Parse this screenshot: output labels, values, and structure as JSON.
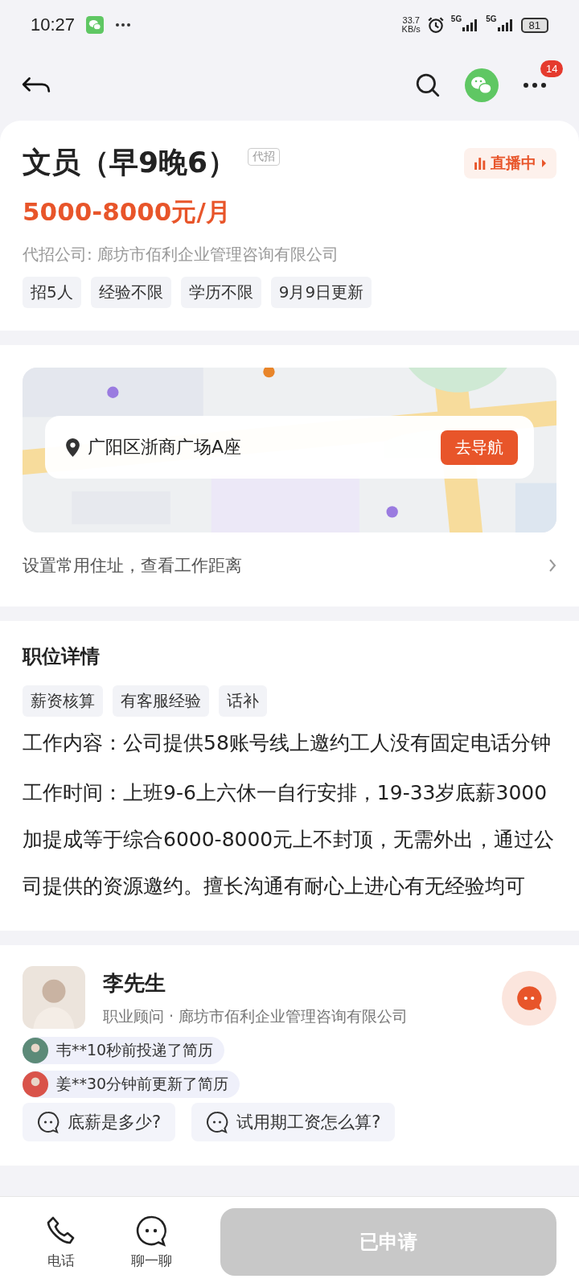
{
  "status_bar": {
    "time": "10:27",
    "net_speed": "33.7",
    "net_unit": "KB/s",
    "signal_1": "5G",
    "signal_2": "5G",
    "battery": "81"
  },
  "nav": {
    "badge": "14"
  },
  "job": {
    "title": "文员（早9晚6）",
    "agency_tag": "代招",
    "live": "直播中",
    "salary": "5000-8000元/月",
    "company": "代招公司: 廊坊市佰利企业管理咨询有限公司",
    "tags": [
      "招5人",
      "经验不限",
      "学历不限",
      "9月9日更新"
    ]
  },
  "location": {
    "address": "广阳区浙商广场A座",
    "nav_button": "去导航",
    "home_link": "设置常用住址，查看工作距离"
  },
  "details": {
    "heading": "职位详情",
    "tags": [
      "薪资核算",
      "有客服经验",
      "话补"
    ],
    "paragraphs": [
      "工作内容：公司提供58账号线上邀约工人没有固定电话分钟",
      "工作时间：上班9-6上六休一自行安排，19-33岁底薪3000加提成等于综合6000-8000元上不封顶，无需外出，通过公司提供的资源邀约。擅长沟通有耐心上进心有无经验均可"
    ]
  },
  "contact": {
    "name": "李先生",
    "role": "职业顾问 · 廊坊市佰利企业管理咨询有限公司",
    "questions": [
      "底薪是多少?",
      "试用期工资怎么算?"
    ]
  },
  "toasts": [
    "韦**10秒前投递了简历",
    "姜**30分钟前更新了简历"
  ],
  "bottom_bar": {
    "actions": [
      {
        "kind": "phone",
        "label": "电话"
      },
      {
        "kind": "chat",
        "label": "聊一聊"
      }
    ],
    "apply_button": "已申请",
    "applied": true
  }
}
